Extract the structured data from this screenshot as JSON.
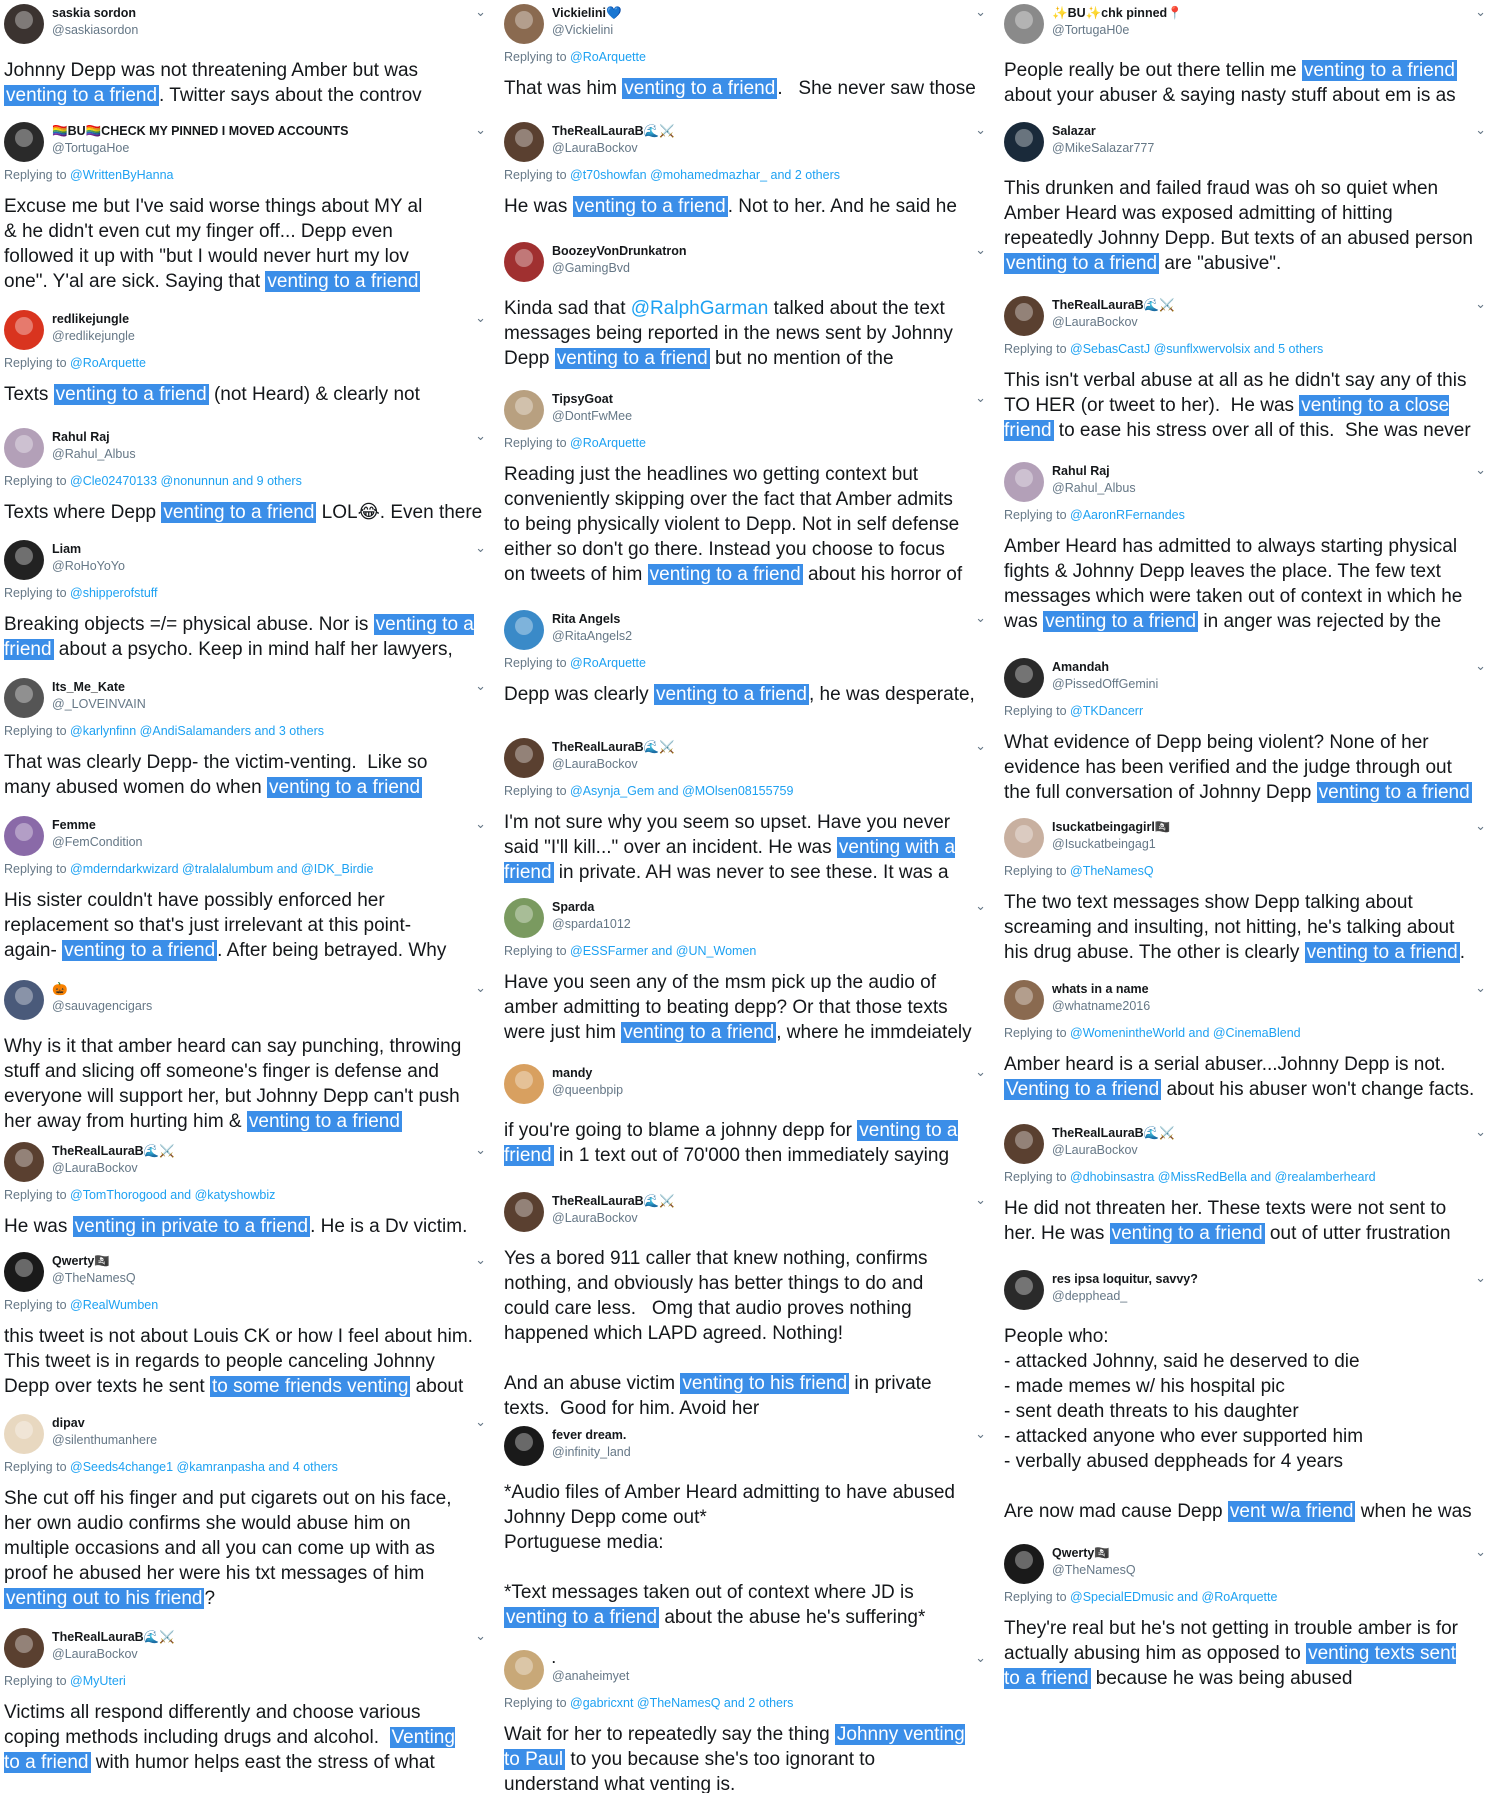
{
  "columns": [
    {
      "tweets": [
        {
          "name": "saskia sordon",
          "handle": "@saskiasordon",
          "reply": "",
          "body": [
            [
              "Johnny Depp was not threatening Amber but was\n",
              ""
            ],
            [
              "venting to a friend",
              "hl"
            ],
            [
              ". Twitter says about the controv",
              ""
            ]
          ],
          "avatar": "#3b3330"
        },
        {
          "name": "🏳️‍🌈BU🏳️‍🌈CHECK MY PINNED I MOVED ACCOUNTS",
          "handle": "@TortugaHoe",
          "reply": "@WrittenByHanna",
          "body": [
            [
              "Excuse me but I've said worse things about MY al\n& he didn't even cut my finger off... Depp even\nfollowed it up with \"but I would never hurt my lov\none\". Y'al are sick. Saying that ",
              ""
            ],
            [
              "venting to a friend",
              "hl"
            ]
          ],
          "avatar": "#2a2a2a"
        },
        {
          "name": "redlikejungle",
          "handle": "@redlikejungle",
          "reply": "@RoArquette",
          "body": [
            [
              "Texts ",
              ""
            ],
            [
              "venting to a friend",
              "hl"
            ],
            [
              " (not Heard) & clearly not",
              ""
            ]
          ],
          "avatar": "#d9341f"
        },
        {
          "name": "Rahul Raj",
          "handle": "@Rahul_Albus",
          "reply": "@Cle02470133 @nonunnun and 9 others",
          "body": [
            [
              "Texts where Depp ",
              ""
            ],
            [
              "venting to a friend",
              "hl"
            ],
            [
              " LOL😂. Even there",
              ""
            ]
          ],
          "avatar": "#b3a0b8"
        },
        {
          "name": "Liam",
          "handle": "@RoHoYoYo",
          "reply": "@shipperofstuff",
          "body": [
            [
              "Breaking objects =/= physical abuse. Nor is ",
              ""
            ],
            [
              "venting to a\nfriend",
              "hl"
            ],
            [
              " about a psycho. Keep in mind half her lawyers,",
              ""
            ]
          ],
          "avatar": "#222222"
        },
        {
          "name": "Its_Me_Kate",
          "handle": "@_LOVEINVAIN",
          "reply": "@karlynfinn @AndiSalamanders and 3 others",
          "body": [
            [
              "That was clearly Depp- the victim-venting.  Like so\nmany abused women do when ",
              ""
            ],
            [
              "venting to a friend",
              "hl"
            ]
          ],
          "avatar": "#555555"
        },
        {
          "name": "Femme",
          "handle": "@FemCondition",
          "reply": "@mderndarkwizard @tralalalumbum and @IDK_Birdie",
          "body": [
            [
              "His sister couldn't have possibly enforced her\nreplacement so that's just irrelevant at this point-\nagain- ",
              ""
            ],
            [
              "venting to a friend",
              "hl"
            ],
            [
              ". After being betrayed. Why",
              ""
            ]
          ],
          "avatar": "#8a6aa8"
        },
        {
          "name": "🎃",
          "handle": "@sauvagencigars",
          "reply": "",
          "body": [
            [
              "Why is it that amber heard can say punching, throwing\nstuff and slicing off someone's finger is defense and\neveryone will support her, but Johnny Depp can't push\nher away from hurting him & ",
              ""
            ],
            [
              "venting to a friend",
              "hl"
            ]
          ],
          "avatar": "#4a5a7a"
        },
        {
          "name": "TheRealLauraB🌊⚔️",
          "handle": "@LauraBockov",
          "reply": "@TomThorogood and @katyshowbiz",
          "body": [
            [
              "He was ",
              ""
            ],
            [
              "venting in private to a friend",
              "hl"
            ],
            [
              ". He is a Dv victim.",
              ""
            ]
          ],
          "avatar": "#5a4030"
        },
        {
          "name": "Qwerty🏴‍☠️",
          "handle": "@TheNamesQ",
          "reply": "@RealWumben",
          "body": [
            [
              "this tweet is not about Louis CK or how I feel about him.\nThis tweet is in regards to people canceling Johnny\nDepp over texts he sent ",
              ""
            ],
            [
              "to some friends venting",
              "hl"
            ],
            [
              " about",
              ""
            ]
          ],
          "avatar": "#1a1a1a"
        },
        {
          "name": "dipav",
          "handle": "@silenthumanhere",
          "reply": "@Seeds4change1 @kamranpasha and 4 others",
          "body": [
            [
              "She cut off his finger and put cigarets out on his face,\nher own audio confirms she would abuse him on\nmultiple occasions and all you can come up with as\nproof he abused her were his txt messages of him\n",
              ""
            ],
            [
              "venting out to his friend",
              "hl"
            ],
            [
              "?",
              ""
            ]
          ],
          "avatar": "#e8d8c0"
        },
        {
          "name": "TheRealLauraB🌊⚔️",
          "handle": "@LauraBockov",
          "reply": "@MyUteri",
          "body": [
            [
              "Victims all respond differently and choose various\ncoping methods including drugs and alcohol.  ",
              ""
            ],
            [
              "Venting\nto a friend",
              "hl"
            ],
            [
              " with humor helps east the stress of what",
              ""
            ]
          ],
          "avatar": "#5a4030"
        }
      ]
    },
    {
      "tweets": [
        {
          "name": "Vickielini💙",
          "handle": "@Vickielini",
          "reply": "@RoArquette",
          "body": [
            [
              "That was him ",
              ""
            ],
            [
              "venting to a friend",
              "hl"
            ],
            [
              ".   She never saw those",
              ""
            ]
          ],
          "avatar": "#8a6a50"
        },
        {
          "name": "TheRealLauraB🌊⚔️",
          "handle": "@LauraBockov",
          "reply": "@t70showfan @mohamedmazhar_ and 2 others",
          "body": [
            [
              "He was ",
              ""
            ],
            [
              "venting to a friend",
              "hl"
            ],
            [
              ". Not to her. And he said he",
              ""
            ]
          ],
          "avatar": "#5a4030"
        },
        {
          "name": "BoozeyVonDrunkatron",
          "handle": "@GamingBvd",
          "reply": "",
          "body": [
            [
              "Kinda sad that ",
              ""
            ],
            [
              "@RalphGarman",
              "mention"
            ],
            [
              " talked about the text\nmessages being reported in the news sent by Johnny\nDepp ",
              ""
            ],
            [
              "venting to a friend",
              "hl"
            ],
            [
              " but no mention of the",
              ""
            ]
          ],
          "avatar": "#a03030"
        },
        {
          "name": "TipsyGoat",
          "handle": "@DontFwMee",
          "reply": "@RoArquette",
          "body": [
            [
              "Reading just the headlines wo getting context but\nconveniently skipping over the fact that Amber admits\nto being physically violent to Depp. Not in self defense\neither so don't go there. Instead you choose to focus\non tweets of him ",
              ""
            ],
            [
              "venting to a friend",
              "hl"
            ],
            [
              " about his horror of",
              ""
            ]
          ],
          "avatar": "#b8a080"
        },
        {
          "name": "Rita Angels",
          "handle": "@RitaAngels2",
          "reply": "@RoArquette",
          "body": [
            [
              "Depp was clearly ",
              ""
            ],
            [
              "venting to a friend",
              "hl"
            ],
            [
              ", he was desperate,",
              ""
            ]
          ],
          "avatar": "#3a8ac8"
        },
        {
          "name": "TheRealLauraB🌊⚔️",
          "handle": "@LauraBockov",
          "reply": "@Asynja_Gem and @MOlsen08155759",
          "body": [
            [
              "I'm not sure why you seem so upset. Have you never\nsaid \"I'll kill...\" over an incident. He was ",
              ""
            ],
            [
              "venting with a\nfriend",
              "hl"
            ],
            [
              " in private. AH was never to see these. It was a",
              ""
            ]
          ],
          "avatar": "#5a4030"
        },
        {
          "name": "Sparda",
          "handle": "@sparda1012",
          "reply": "@ESSFarmer and @UN_Women",
          "body": [
            [
              "Have you seen any of the msm pick up the audio of\namber admitting to beating depp? Or that those texts\nwere just him ",
              ""
            ],
            [
              "venting to a friend",
              "hl"
            ],
            [
              ", where he immdeiately",
              ""
            ]
          ],
          "avatar": "#7a9a60"
        },
        {
          "name": "mandy",
          "handle": "@queenbpip",
          "reply": "",
          "body": [
            [
              "if you're going to blame a johnny depp for ",
              ""
            ],
            [
              "venting to a\nfriend",
              "hl"
            ],
            [
              " in 1 text out of 70'000 then immediately saying",
              ""
            ]
          ],
          "avatar": "#d8a060"
        },
        {
          "name": "TheRealLauraB🌊⚔️",
          "handle": "@LauraBockov",
          "reply": "",
          "body": [
            [
              "Yes a bored 911 caller that knew nothing, confirms\nnothing, and obviously has better things to do and\ncould care less.   Omg that audio proves nothing\nhappened which LAPD agreed. Nothing!\n\nAnd an abuse victim ",
              ""
            ],
            [
              "venting to his friend",
              "hl"
            ],
            [
              " in private\ntexts.  Good for him. Avoid her",
              ""
            ]
          ],
          "avatar": "#5a4030"
        },
        {
          "name": "fever dream.",
          "handle": "@infinity_land",
          "reply": "",
          "body": [
            [
              "*Audio files of Amber Heard admitting to have abused\nJohnny Depp come out*\nPortuguese media:\n\n*Text messages taken out of context where JD is\n",
              ""
            ],
            [
              "venting to a friend",
              "hl"
            ],
            [
              " about the abuse he's suffering*",
              ""
            ]
          ],
          "avatar": "#1a1a1a"
        },
        {
          "name": ".",
          "handle": "@anaheimyet",
          "reply": "@gabricxnt @TheNamesQ and 2 others",
          "body": [
            [
              "Wait for her to repeatedly say the thing ",
              ""
            ],
            [
              "Johnny venting\nto Paul",
              "hl"
            ],
            [
              " to you because she's too ignorant to\nunderstand what venting is.",
              ""
            ]
          ],
          "avatar": "#c8a878"
        }
      ]
    },
    {
      "tweets": [
        {
          "name": "✨BU✨chk pinned📍",
          "handle": "@TortugaH0e",
          "reply": "",
          "body": [
            [
              "People really be out there tellin me ",
              ""
            ],
            [
              "venting to a friend",
              "hl"
            ],
            [
              "\nabout your abuser & saying nasty stuff about em is as",
              ""
            ]
          ],
          "avatar": "#8a8a8a"
        },
        {
          "name": "Salazar",
          "handle": "@MikeSalazar777",
          "reply": "",
          "body": [
            [
              "This drunken and failed fraud was oh so quiet when\nAmber Heard was exposed admitting of hitting\nrepeatedly Johnny Depp. But texts of an abused person\n",
              ""
            ],
            [
              "venting to a friend",
              "hl"
            ],
            [
              " are \"abusive\".",
              ""
            ]
          ],
          "avatar": "#1a2a3a"
        },
        {
          "name": "TheRealLauraB🌊⚔️",
          "handle": "@LauraBockov",
          "reply": "@SebasCastJ @sunflxwervolsix and 5 others",
          "body": [
            [
              "This isn't verbal abuse at all as he didn't say any of this\nTO HER (or tweet to her).  He was ",
              ""
            ],
            [
              "venting to a close\nfriend",
              "hl"
            ],
            [
              " to ease his stress over all of this.  She was never",
              ""
            ]
          ],
          "avatar": "#5a4030"
        },
        {
          "name": "Rahul Raj",
          "handle": "@Rahul_Albus",
          "reply": "@AaronRFernandes",
          "body": [
            [
              "Amber Heard has admitted to always starting physical\nfights & Johnny Depp leaves the place. The few text\nmessages which were taken out of context in which he\nwas ",
              ""
            ],
            [
              "venting to a friend",
              "hl"
            ],
            [
              " in anger was rejected by the",
              ""
            ]
          ],
          "avatar": "#b3a0b8"
        },
        {
          "name": "Amandah",
          "handle": "@PissedOffGemini",
          "reply": "@TKDancerr",
          "body": [
            [
              "What evidence of Depp being violent? None of her\nevidence has been verified and the judge through out\nthe full conversation of Johnny Depp ",
              ""
            ],
            [
              "venting to a friend",
              "hl"
            ]
          ],
          "avatar": "#2a2a2a"
        },
        {
          "name": "Isuckatbeingagirl🏴‍☠️",
          "handle": "@Isuckatbeingag1",
          "reply": "@TheNamesQ",
          "body": [
            [
              "The two text messages show Depp talking about\nscreaming and insulting, not hitting, he's talking about\nhis drug abuse. The other is clearly ",
              ""
            ],
            [
              "venting to a friend",
              "hl"
            ],
            [
              ".",
              ""
            ]
          ],
          "avatar": "#c8b0a0"
        },
        {
          "name": "whats in a name",
          "handle": "@whatname2016",
          "reply": "@WomenintheWorld and @CinemaBlend",
          "body": [
            [
              "Amber heard is a serial abuser...Johnny Depp is not.\n",
              ""
            ],
            [
              "Venting to a friend",
              "hl"
            ],
            [
              " about his abuser won't change facts.",
              ""
            ]
          ],
          "avatar": "#8a6a50"
        },
        {
          "name": "TheRealLauraB🌊⚔️",
          "handle": "@LauraBockov",
          "reply": "@dhobinsastra @MissRedBella and @realamberheard",
          "body": [
            [
              "He did not threaten her. These texts were not sent to\nher. He was ",
              ""
            ],
            [
              "venting to a friend",
              "hl"
            ],
            [
              " out of utter frustration",
              ""
            ]
          ],
          "avatar": "#5a4030"
        },
        {
          "name": "res ipsa loquitur, savvy?",
          "handle": "@depphead_",
          "reply": "",
          "body": [
            [
              "People who:\n- attacked Johnny, said he deserved to die\n- made memes w/ his hospital pic\n- sent death threats to his daughter\n- attacked anyone who ever supported him\n- verbally abused deppheads for 4 years\n\nAre now mad cause Depp ",
              ""
            ],
            [
              "vent w/a friend",
              "hl"
            ],
            [
              " when he was",
              ""
            ]
          ],
          "avatar": "#2a2a2a"
        },
        {
          "name": "Qwerty🏴‍☠️",
          "handle": "@TheNamesQ",
          "reply": "@SpecialEDmusic and @RoArquette",
          "body": [
            [
              "They're real but he's not getting in trouble amber is for\nactually abusing him as opposed to ",
              ""
            ],
            [
              "venting texts sent\nto a friend",
              "hl"
            ],
            [
              " because he was being abused",
              ""
            ]
          ],
          "avatar": "#1a1a1a"
        }
      ]
    }
  ],
  "labels": {
    "replying_prefix": "Replying to ",
    "caret": "⌄"
  },
  "colors": {
    "highlight": "#3b8ee8",
    "link": "#1da1f2",
    "muted": "#657786",
    "text": "#14171a"
  }
}
